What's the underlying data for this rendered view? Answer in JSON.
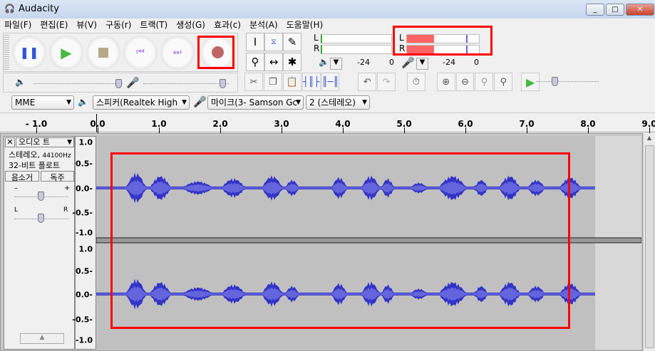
{
  "window": {
    "title": "Audacity",
    "minimize": "_",
    "maximize": "□",
    "close": "✕"
  },
  "menu": [
    "파일(F)",
    "편집(E)",
    "뷰(V)",
    "구동(r)",
    "트랙(T)",
    "생성(G)",
    "효과(c)",
    "분석(A)",
    "도움말(H)"
  ],
  "meters": {
    "play": {
      "L": "L",
      "R": "R",
      "ticks": [
        "-24",
        "0"
      ]
    },
    "record": {
      "L": "L",
      "R": "R",
      "ticks": [
        "-24",
        "0"
      ],
      "level": 0.38,
      "peak": 0.82
    }
  },
  "device": {
    "host": "MME",
    "output": "스피커(Realtek High",
    "input": "마이크(3- Samson Gc",
    "channels": "2 (스테레오)"
  },
  "ruler": [
    "- 1.0",
    "0.0",
    "1.0",
    "2.0",
    "3.0",
    "4.0",
    "5.0",
    "6.0",
    "7.0",
    "8.0",
    "9.0"
  ],
  "track": {
    "close": "✕",
    "name": "오디오 트",
    "info1": "스테레오,",
    "rate": "44100Hz",
    "info2": "32-비트 플로트",
    "mute": "음소거",
    "solo": "독주",
    "gain_minus": "–",
    "gain_plus": "+",
    "pan_l": "L",
    "pan_r": "R"
  },
  "yaxis": [
    "1.0",
    "0.5-",
    "0.0-",
    "-0.5-",
    "-1.0"
  ],
  "colors": {
    "wave": "#3232c8",
    "waveRms": "#6464dc",
    "bg": "#c0c0c0",
    "highlight": "#ff0000"
  }
}
